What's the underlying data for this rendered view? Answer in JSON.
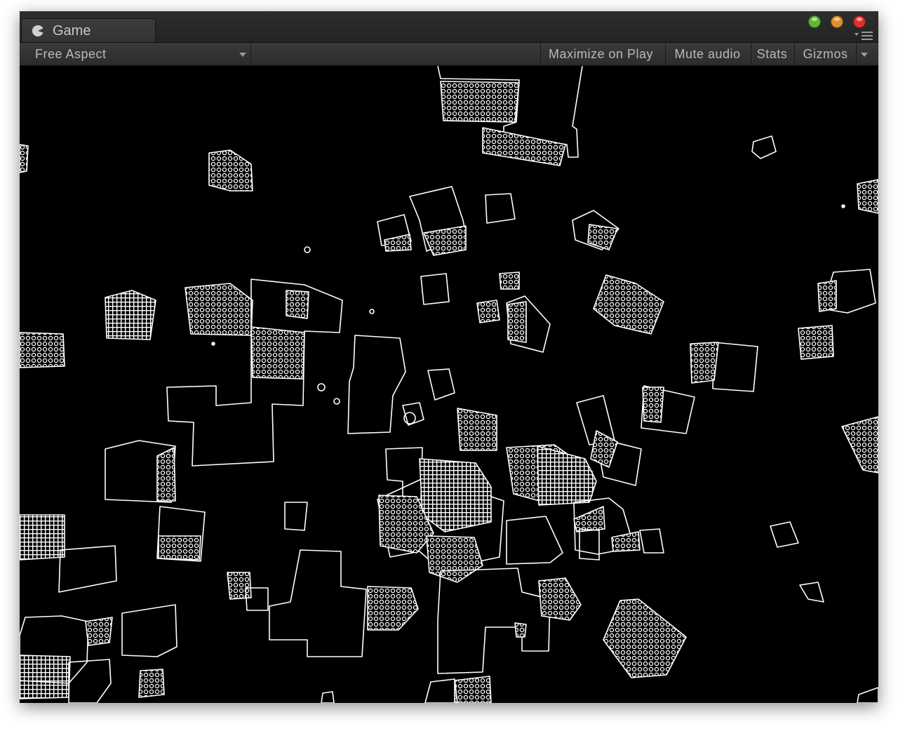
{
  "window": {
    "tab_title": "Game",
    "tab_icon": "pacman-icon",
    "traffic_lights": [
      {
        "name": "zoom-light",
        "color": "#5cb832"
      },
      {
        "name": "minimize-light",
        "color": "#e0902c"
      },
      {
        "name": "close-light",
        "color": "#e0302c"
      }
    ]
  },
  "toolbar": {
    "aspect_value": "Free Aspect",
    "maximize_label": "Maximize on Play",
    "mute_label": "Mute audio",
    "stats_label": "Stats",
    "gizmos_label": "Gizmos"
  },
  "colors": {
    "viewport_background": "#000000",
    "outline": "#ffffff",
    "toolbar_text": "#b9b9b9"
  }
}
